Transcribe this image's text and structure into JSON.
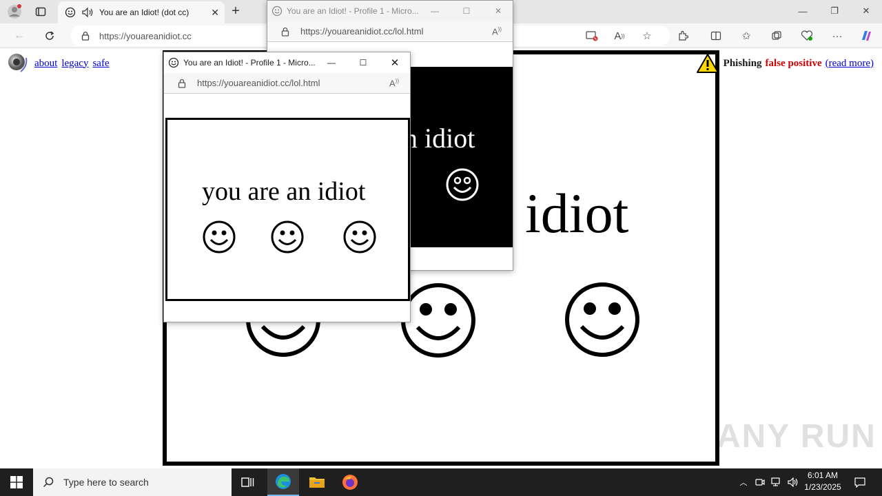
{
  "browser": {
    "tab_title": "You are an Idiot! (dot cc)",
    "url": "https://youareanidiot.cc"
  },
  "page": {
    "nav_links": [
      "about",
      "legacy",
      "safe"
    ],
    "phishing": {
      "label": "Phishing",
      "status": "false positive",
      "link": "(read more)"
    },
    "big_text": "idiot"
  },
  "popup_back": {
    "title": "You are an Idiot! - Profile 1 - Micro...",
    "url": "https://youareanidiot.cc/lol.html",
    "text": "n idiot",
    "bg": "#000000"
  },
  "popup_front": {
    "title": "You are an Idiot! - Profile 1 - Micro...",
    "url": "https://youareanidiot.cc/lol.html",
    "text": "you are an idiot",
    "bg": "#ffffff"
  },
  "watermark": "ANY RUN",
  "taskbar": {
    "search_placeholder": "Type here to search",
    "time": "6:01 AM",
    "date": "1/23/2025"
  },
  "colors": {
    "warning_red": "#cc0000",
    "link_blue": "#0000cc"
  }
}
